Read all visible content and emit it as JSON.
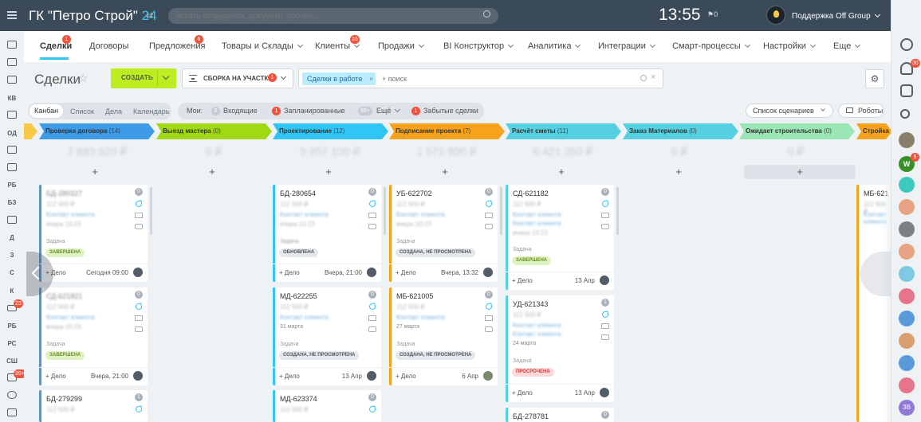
{
  "topbar": {
    "title": "ГК \"Петро Строй\"",
    "title_num": "24",
    "swap_icon": "⇄",
    "search_placeholder": "искать сотрудника, документ, прочее...",
    "clock": "13:55",
    "flag_count": "0",
    "support": "Поддержка Off Group",
    "help": "?"
  },
  "nav": {
    "items": [
      {
        "label": "Сделки",
        "badge": "1"
      },
      {
        "label": "Договоры"
      },
      {
        "label": "Предложения",
        "badge": "6"
      },
      {
        "label": "Товары и Склады"
      },
      {
        "label": "Клиенты",
        "badge": "16"
      },
      {
        "label": "Продажи"
      },
      {
        "label": "BI Конструктор"
      },
      {
        "label": "Аналитика"
      },
      {
        "label": "Интеграции"
      },
      {
        "label": "Смарт-процессы"
      },
      {
        "label": "Настройки"
      },
      {
        "label": "Еще"
      }
    ]
  },
  "toolbar": {
    "page_title": "Сделки",
    "create": "СОЗДАТЬ",
    "stage_filter": "СБОРКА НА УЧАСТКЕ",
    "stage_filter_badge": "1",
    "filter_chip": "Сделки в работе",
    "filter_placeholder": "+ поиск"
  },
  "views": {
    "tabs": [
      "Канбан",
      "Список",
      "Дела",
      "Календарь"
    ],
    "active": "Канбан",
    "my_label": "Мои:",
    "incoming_count": "0",
    "incoming": "Входящие",
    "planned_count": "1",
    "planned": "Запланированные",
    "more_count": "99+",
    "more": "Ещё",
    "forgotten_count": "1",
    "forgotten": "Забытые сделки",
    "scenarios": "Список сценариев",
    "robots": "Роботы"
  },
  "stages": [
    {
      "name": "Проверка договора",
      "count": "(14)",
      "color": "#3d9be8"
    },
    {
      "name": "Выезд мастера",
      "count": "(0)",
      "color": "#a0d911"
    },
    {
      "name": "Проектирование",
      "count": "(12)",
      "color": "#2fc6f6"
    },
    {
      "name": "Подписание проекта",
      "count": "(7)",
      "color": "#f7a21b"
    },
    {
      "name": "Расчёт сметы",
      "count": "(11)",
      "color": "#55d0e0"
    },
    {
      "name": "Заказ Материалов",
      "count": "(0)",
      "color": "#55d0e0"
    },
    {
      "name": "Ожидает строительства",
      "count": "(0)",
      "color": "#9ae6b4"
    },
    {
      "name": "Стройка",
      "count": "",
      "color": "#f7a21b"
    }
  ],
  "sums": [
    "7 683 920 ₽",
    "0 ₽",
    "5 957 100 ₽",
    "1 571 800 ₽",
    "6 421 350 ₽",
    "0 ₽",
    "0 ₽",
    "4"
  ],
  "plus": "+",
  "cards": {
    "c1": {
      "title": "БД-280327",
      "date": "",
      "task": "Задача",
      "tag": "ЗАВЕРШЕНА",
      "add": "+ Дело",
      "when": "Сегодня 09:00",
      "num": "0"
    },
    "c2": {
      "title": "СД-621821",
      "date": "",
      "task": "Задача",
      "tag": "ЗАВЕРШЕНА",
      "add": "+ Дело",
      "when": "Вчера, 21:00",
      "num": "0"
    },
    "c3": {
      "title": "БД-279299",
      "num": "1"
    },
    "c4": {
      "title": "БД-280654",
      "date": "",
      "task": "Задача",
      "tag": "ОБНОВЛЕНА",
      "add": "+ Дело",
      "when": "Вчера, 21:00",
      "num": "0"
    },
    "c5": {
      "title": "МД-622255",
      "date": "31 марта",
      "task": "Задача",
      "tag": "СОЗДАНА, НЕ ПРОСМОТРЕНА",
      "add": "+ Дело",
      "when": "13 Апр",
      "num": "0"
    },
    "c6": {
      "title": "МД-623374",
      "num": "0"
    },
    "c7": {
      "title": "УБ-622702",
      "date": "",
      "task": "Задача",
      "tag": "СОЗДАНА, НЕ ПРОСМОТРЕНА",
      "add": "+ Дело",
      "when": "Вчера, 13:32",
      "num": "0"
    },
    "c8": {
      "title": "МБ-621005",
      "date": "27 марта",
      "task": "Задача",
      "tag": "СОЗДАНА, НЕ ПРОСМОТРЕНА",
      "add": "+ Дело",
      "when": "6 Апр",
      "num": "0"
    },
    "c9": {
      "title": "СД-621182",
      "date": "",
      "task": "Задача",
      "tag": "ЗАВЕРШЕНА",
      "add": "+ Дело",
      "when": "13 Апр",
      "num": "0"
    },
    "c10": {
      "title": "УД-621343",
      "date": "24 марта",
      "task": "Задача",
      "tag": "ПРОСРОЧЕНА",
      "add": "+ Дело",
      "when": "13 Апр",
      "num": "1"
    },
    "c11": {
      "title": "БД-278781",
      "num": "0"
    },
    "c12": {
      "title": "МБ-621"
    }
  },
  "blur": {
    "sum": "112 500 ₽",
    "name": "Контакт клиента",
    "note": "вчера 10:23"
  },
  "left_sidebar": {
    "labels": [
      "КВ",
      "ОД",
      "РБ",
      "БЗ",
      "Д",
      "З",
      "С",
      "К",
      "РБ",
      "РС",
      "СШ"
    ],
    "badge_filter": "23",
    "badge_mail": "99+"
  },
  "right_sidebar": {
    "notify": "30",
    "w_letter": "W",
    "w_badge": "5",
    "last": "ЗВ"
  }
}
